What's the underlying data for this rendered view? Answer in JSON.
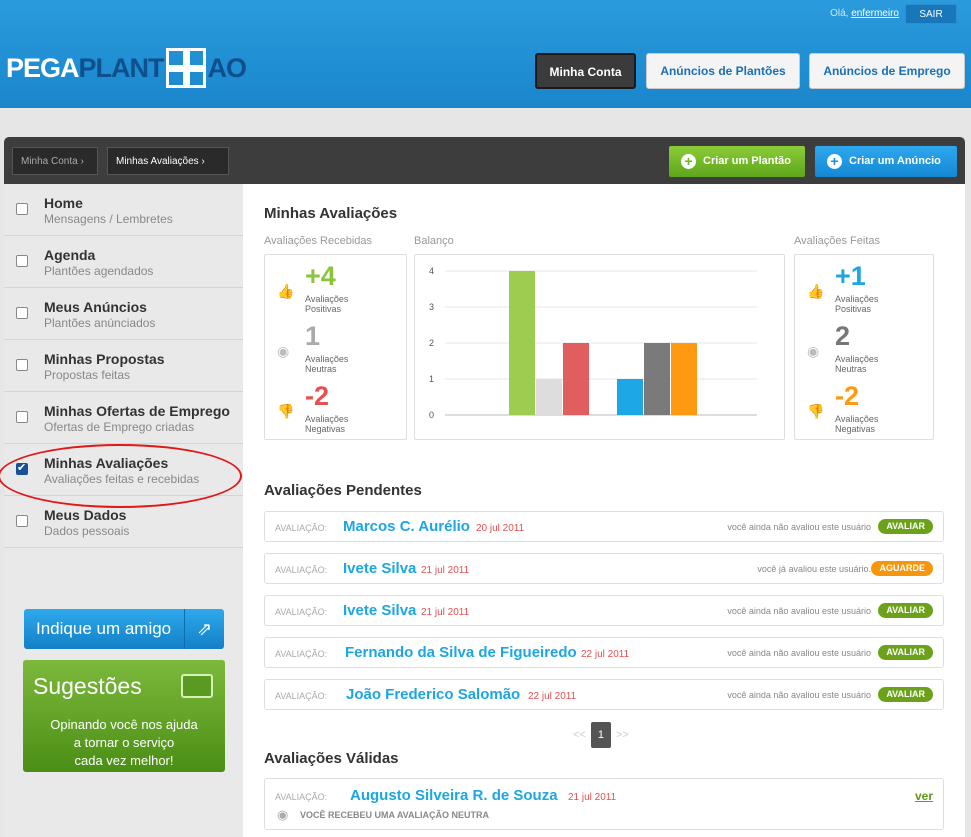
{
  "header": {
    "greeting": "Olá,",
    "username": "enfermeiro",
    "logout": "SAIR",
    "logo_part1": "PEGA",
    "logo_part2": "PLANT",
    "logo_part3": "AO",
    "nav": [
      "Minha Conta",
      "Anúncios de Plantões",
      "Anúncios de Emprego"
    ]
  },
  "toolbar": {
    "breadcrumb": [
      "Minha Conta ›",
      "Minhas Avaliações ›"
    ],
    "create_shift": "Criar um Plantão",
    "create_ad": "Criar um Anúncio"
  },
  "sidebar": {
    "items": [
      {
        "title": "Home",
        "subtitle": "Mensagens / Lembretes"
      },
      {
        "title": "Agenda",
        "subtitle": "Plantões agendados"
      },
      {
        "title": "Meus Anúncios",
        "subtitle": "Plantões anúnciados"
      },
      {
        "title": "Minhas Propostas",
        "subtitle": "Propostas feitas"
      },
      {
        "title": "Minhas Ofertas de Emprego",
        "subtitle": "Ofertas de Emprego criadas"
      },
      {
        "title": "Minhas Avaliações",
        "subtitle": "Avaliações feitas e recebidas"
      },
      {
        "title": "Meus Dados",
        "subtitle": "Dados pessoais"
      }
    ],
    "refer": "Indique um amigo",
    "suggestions_title": "Sugestões",
    "suggestions_text": [
      "Opinando você nos ajuda",
      "a tornar o serviço",
      "cada vez melhor!"
    ]
  },
  "main": {
    "title": "Minhas Avaliações",
    "received_caption": "Avaliações Recebidas",
    "balance_caption": "Balanço",
    "made_caption": "Avaliações Feitas",
    "received": {
      "positive": "+4",
      "positive_label": [
        "Avaliações",
        "Positivas"
      ],
      "neutral": "1",
      "neutral_label": [
        "Avaliações",
        "Neutras"
      ],
      "negative": "-2",
      "negative_label": [
        "Avaliações",
        "Negativas"
      ]
    },
    "made": {
      "positive": "+1",
      "positive_label": [
        "Avaliações",
        "Positivas"
      ],
      "neutral": "2",
      "neutral_label": [
        "Avaliações",
        "Neutras"
      ],
      "negative": "-2",
      "negative_label": [
        "Avaliações",
        "Negativas"
      ]
    },
    "pending_title": "Avaliações Pendentes",
    "pending": [
      {
        "label": "AVALIAÇÃO:",
        "name": "Marcos C. Aurélio",
        "date": "20 jul 2011",
        "status": "você ainda não avaliou este usuário",
        "badge": "AVALIAR",
        "badge_color": "#6ba21a"
      },
      {
        "label": "AVALIAÇÃO:",
        "name": "Ivete Silva",
        "date": "21 jul 2011",
        "status": "você já avaliou este usuário.",
        "badge": "AGUARDE",
        "badge_color": "#f7950d"
      },
      {
        "label": "AVALIAÇÃO:",
        "name": "Ivete Silva",
        "date": "21 jul 2011",
        "status": "você ainda não avaliou este usuário",
        "badge": "AVALIAR",
        "badge_color": "#6ba21a"
      },
      {
        "label": "AVALIAÇÃO:",
        "name": "Fernando da Silva de Figueiredo",
        "date": "22 jul 2011",
        "status": "você ainda não avaliou este usuário",
        "badge": "AVALIAR",
        "badge_color": "#6ba21a"
      },
      {
        "label": "AVALIAÇÃO:",
        "name": "João Frederico Salomão",
        "date": "22 jul 2011",
        "status": "você ainda não avaliou este usuário",
        "badge": "AVALIAR",
        "badge_color": "#6ba21a"
      }
    ],
    "pager": {
      "prev": "<<",
      "current": "1",
      "next": ">>"
    },
    "valid_title": "Avaliações Válidas",
    "valid": {
      "label": "AVALIAÇÃO:",
      "name": "Augusto Silveira R. de Souza",
      "date": "21 jul 2011",
      "link": "ver",
      "message": "VOCÊ RECEBEU UMA AVALIAÇÃO NEUTRA"
    }
  },
  "chart_data": {
    "type": "bar",
    "ylim": [
      0,
      4
    ],
    "yticks": [
      "0",
      "1",
      "2",
      "3",
      "4"
    ],
    "groups": [
      {
        "values": [
          4,
          1,
          2
        ],
        "colors": [
          "#9ccc50",
          "#dddddd",
          "#e05e5e"
        ]
      },
      {
        "values": [
          1,
          2,
          2
        ],
        "colors": [
          "#1ea7e6",
          "#7a7a7a",
          "#ff9912"
        ]
      }
    ]
  }
}
